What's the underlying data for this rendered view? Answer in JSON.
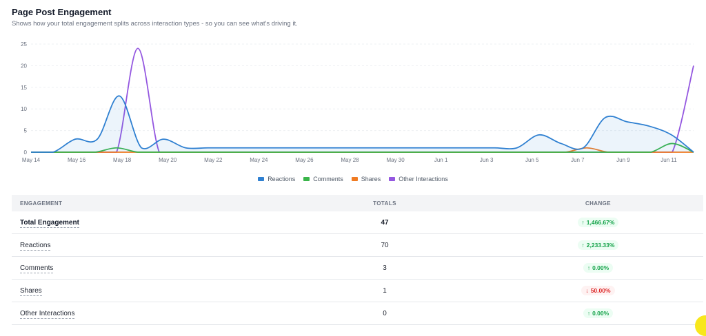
{
  "header": {
    "title": "Page Post Engagement",
    "subtitle": "Shows how your total engagement splits across interaction types - so you can see what's driving it."
  },
  "chart_data": {
    "type": "area",
    "ylim": [
      0,
      25
    ],
    "yticks": [
      0,
      5,
      10,
      15,
      20,
      25
    ],
    "xlabels": [
      "May 14",
      "May 16",
      "May 18",
      "May 20",
      "May 22",
      "May 24",
      "May 26",
      "May 28",
      "May 30",
      "Jun 1",
      "Jun 3",
      "Jun 5",
      "Jun 7",
      "Jun 9",
      "Jun 11"
    ],
    "grid": true,
    "legend_position": "bottom",
    "series": [
      {
        "name": "Reactions",
        "color": "#2f80d1",
        "fill": true,
        "values": [
          0,
          0,
          3,
          3,
          13,
          1,
          3,
          1,
          1,
          1,
          1,
          1,
          1,
          1,
          1,
          1,
          1,
          1,
          1,
          1,
          1,
          1,
          1,
          4,
          2,
          1,
          8,
          7,
          6,
          4,
          0
        ]
      },
      {
        "name": "Comments",
        "color": "#3ab54a",
        "fill": false,
        "values": [
          0,
          0,
          0,
          0,
          1,
          0,
          0,
          0,
          0,
          0,
          0,
          0,
          0,
          0,
          0,
          0,
          0,
          0,
          0,
          0,
          0,
          0,
          0,
          0,
          0,
          0,
          0,
          0,
          0,
          0,
          2,
          0
        ]
      },
      {
        "name": "Shares",
        "color": "#f07b22",
        "fill": false,
        "values": [
          0,
          0,
          0,
          0,
          0,
          0,
          0,
          0,
          0,
          0,
          0,
          0,
          0,
          0,
          0,
          0,
          0,
          0,
          0,
          0,
          0,
          0,
          0,
          0,
          0,
          0,
          1,
          0,
          0,
          0,
          0,
          0
        ]
      },
      {
        "name": "Other Interactions",
        "color": "#9457e0",
        "fill": false,
        "values": [
          0,
          0,
          0,
          0,
          0,
          24,
          0,
          0,
          0,
          0,
          0,
          0,
          0,
          0,
          0,
          0,
          0,
          0,
          0,
          0,
          0,
          0,
          0,
          0,
          0,
          0,
          0,
          0,
          0,
          0,
          0,
          20
        ]
      }
    ]
  },
  "table": {
    "headers": {
      "engagement": "ENGAGEMENT",
      "totals": "TOTALS",
      "change": "CHANGE"
    },
    "rows": [
      {
        "label": "Total Engagement",
        "total": "47",
        "change": "1,466.67%",
        "dir": "up"
      },
      {
        "label": "Reactions",
        "total": "70",
        "change": "2,233.33%",
        "dir": "up"
      },
      {
        "label": "Comments",
        "total": "3",
        "change": "0.00%",
        "dir": "up"
      },
      {
        "label": "Shares",
        "total": "1",
        "change": "50.00%",
        "dir": "down"
      },
      {
        "label": "Other Interactions",
        "total": "0",
        "change": "0.00%",
        "dir": "up"
      }
    ]
  },
  "icons": {
    "up": "arrow-up-icon",
    "down": "arrow-down-icon"
  }
}
